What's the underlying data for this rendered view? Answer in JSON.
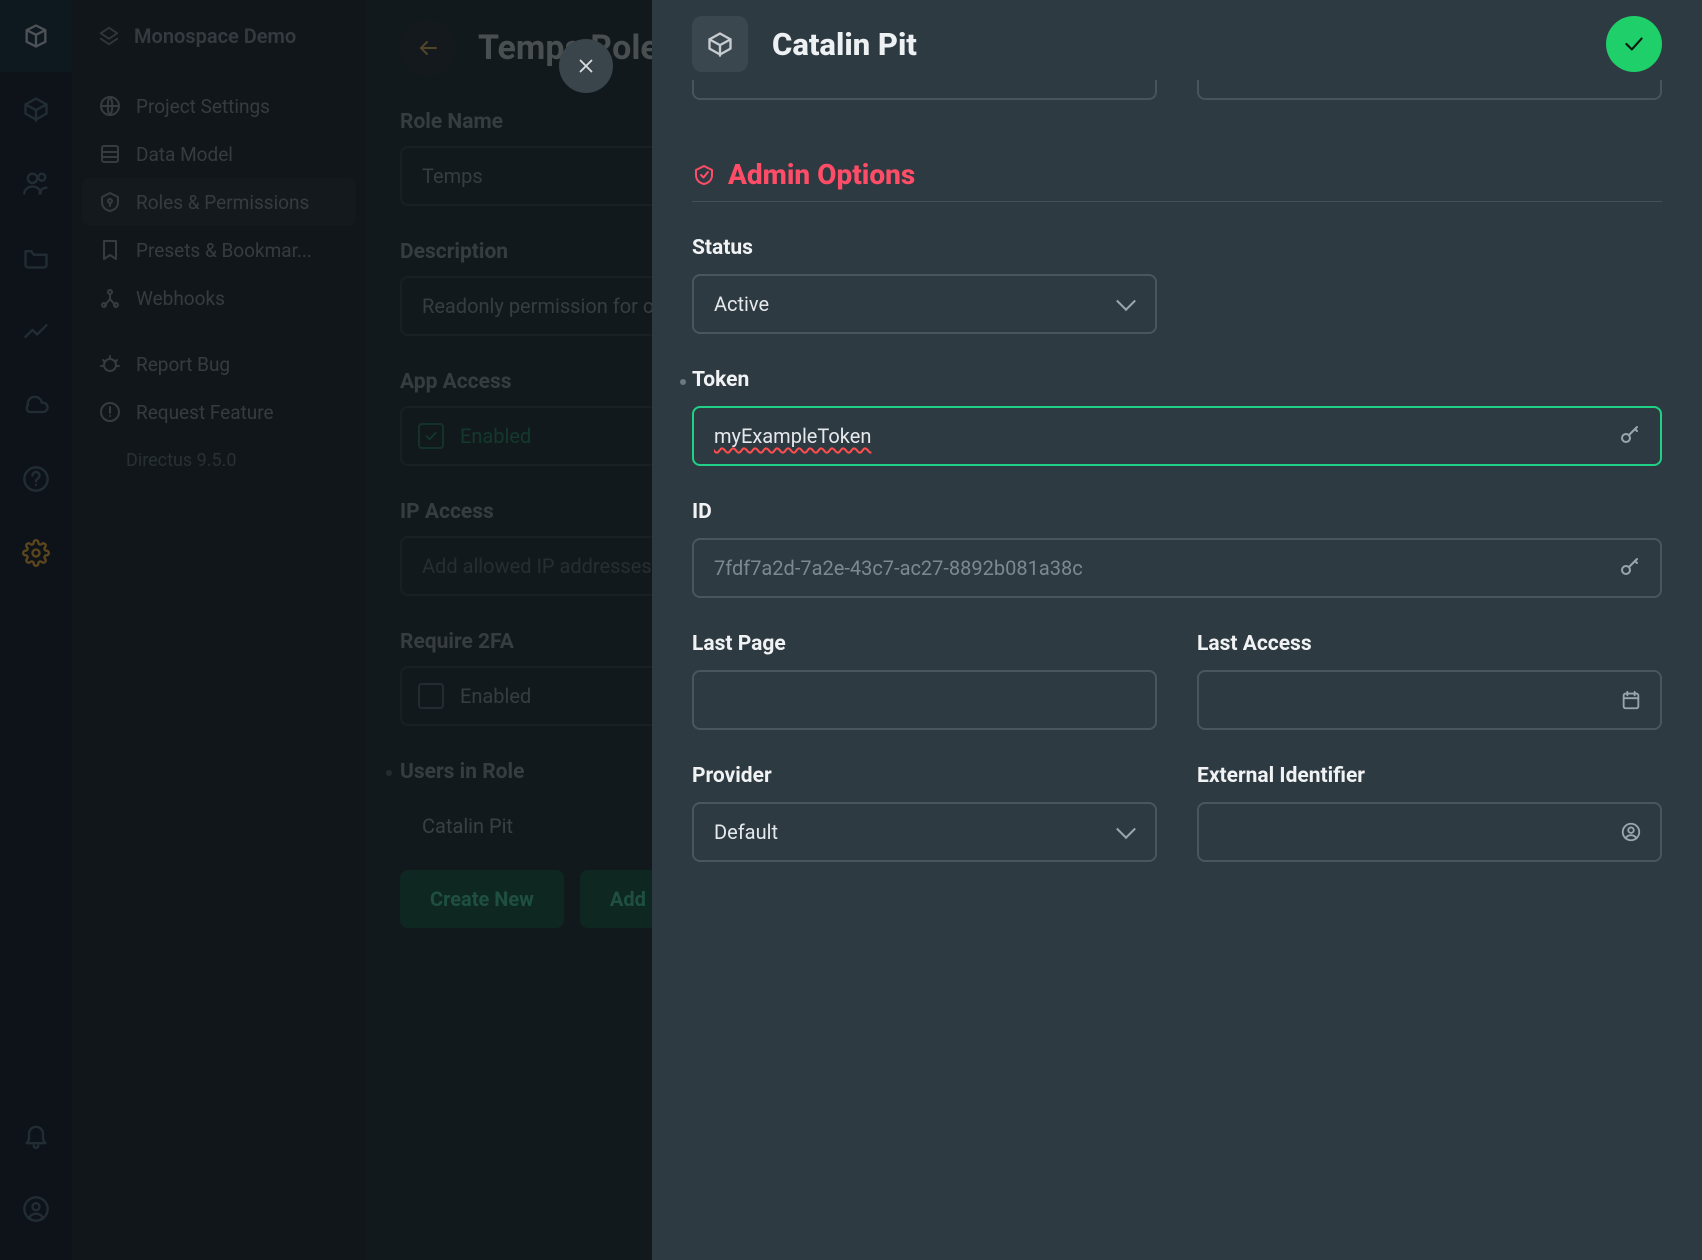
{
  "workspace": "Monospace Demo",
  "sidebar": {
    "items": [
      {
        "label": "Project Settings"
      },
      {
        "label": "Data Model"
      },
      {
        "label": "Roles & Permissions"
      },
      {
        "label": "Presets & Bookmar..."
      },
      {
        "label": "Webhooks"
      },
      {
        "label": "Report Bug"
      },
      {
        "label": "Request Feature"
      }
    ],
    "version": "Directus 9.5.0"
  },
  "role": {
    "title": "Temps Role",
    "labels": {
      "role_name": "Role Name",
      "description": "Description",
      "app_access": "App Access",
      "ip_access": "IP Access",
      "require_2fa": "Require 2FA",
      "users_in_role": "Users in Role",
      "enabled": "Enabled"
    },
    "name": "Temps",
    "description": "Readonly permission for ou",
    "ip_placeholder": "Add allowed IP addresses,",
    "users": [
      "Catalin Pit"
    ],
    "buttons": {
      "create_new": "Create New",
      "add_existing": "Add E"
    }
  },
  "drawer": {
    "title": "Catalin Pit",
    "section": "Admin Options",
    "fields": {
      "status": {
        "label": "Status",
        "value": "Active"
      },
      "token": {
        "label": "Token",
        "value": "myExampleToken"
      },
      "id": {
        "label": "ID",
        "value": "7fdf7a2d-7a2e-43c7-ac27-8892b081a38c"
      },
      "last_page": {
        "label": "Last Page",
        "value": ""
      },
      "last_access": {
        "label": "Last Access",
        "value": ""
      },
      "provider": {
        "label": "Provider",
        "value": "Default"
      },
      "external_id": {
        "label": "External Identifier",
        "value": ""
      }
    }
  }
}
